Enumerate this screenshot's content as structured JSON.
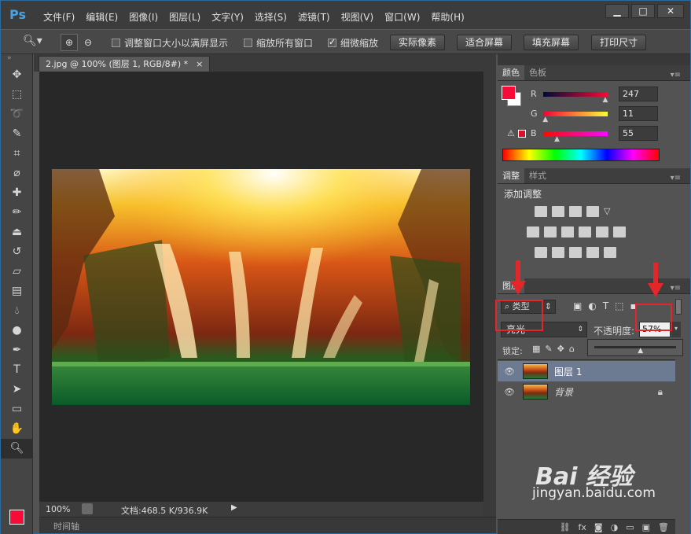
{
  "app": {
    "logo": "Ps"
  },
  "menu": [
    "文件(F)",
    "编辑(E)",
    "图像(I)",
    "图层(L)",
    "文字(Y)",
    "选择(S)",
    "滤镜(T)",
    "视图(V)",
    "窗口(W)",
    "帮助(H)"
  ],
  "options": {
    "resize_windows": "调整窗口大小以满屏显示",
    "zoom_all_windows": "缩放所有窗口",
    "scrubby_zoom": "细微缩放",
    "actual_pixels": "实际像素",
    "fit_screen": "适合屏幕",
    "fill_screen": "填充屏幕",
    "print_size": "打印尺寸"
  },
  "document": {
    "tab_title": "2.jpg @ 100% (图层 1, RGB/8#) *",
    "zoom": "100%",
    "doc_size": "文档:468.5 K/936.9K",
    "timeline": "时间轴"
  },
  "color_panel": {
    "tab_active": "颜色",
    "tab_other": "色板",
    "r_label": "R",
    "g_label": "G",
    "b_label": "B",
    "r": "247",
    "g": "11",
    "b": "55",
    "r_pct": 0.97,
    "g_pct": 0.04,
    "b_pct": 0.22,
    "foreground": "#f70b37"
  },
  "adjust_panel": {
    "tab_active": "调整",
    "tab_other": "样式",
    "title": "添加调整"
  },
  "layers_panel": {
    "tab": "图层",
    "filter_kind": "类型",
    "blend_mode": "亮光",
    "opacity_label": "不透明度:",
    "opacity": "57%",
    "opacity_pct": 0.57,
    "lock_label": "锁定:",
    "layers": [
      {
        "name": "图层 1",
        "selected": true
      },
      {
        "name": "背景",
        "selected": false
      }
    ]
  },
  "watermark": {
    "brand": "Bai 经验",
    "url": "jingyan.baidu.com"
  }
}
